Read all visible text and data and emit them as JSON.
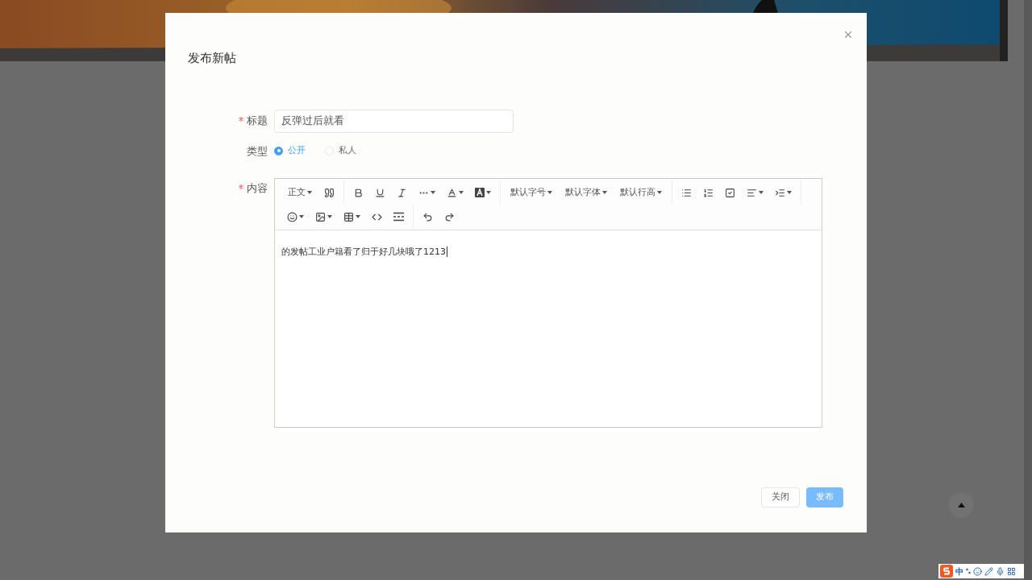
{
  "dialog": {
    "title": "发布新帖"
  },
  "form": {
    "title_field": {
      "label": "标题",
      "required": true,
      "value": "反弹过后就看"
    },
    "type_field": {
      "label": "类型",
      "options": [
        {
          "label": "公开",
          "selected": true
        },
        {
          "label": "私人",
          "selected": false
        }
      ]
    },
    "content_field": {
      "label": "内容",
      "required": true,
      "value": "的发帖工业户籍看了归于好几块哦了1213"
    }
  },
  "toolbar": {
    "paragraph": "正文",
    "font_size": "默认字号",
    "font_family": "默认字体",
    "line_height": "默认行高"
  },
  "buttons": [
    {
      "label": "关闭",
      "kind": "default"
    },
    {
      "label": "发布",
      "kind": "primary"
    }
  ],
  "ime": {
    "mode": "中"
  }
}
